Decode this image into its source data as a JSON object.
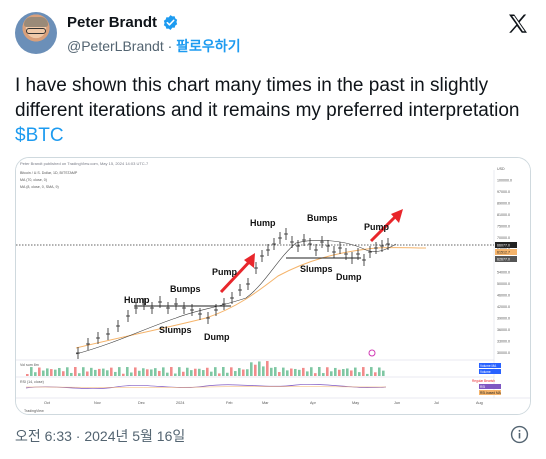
{
  "author": {
    "name": "Peter Brandt",
    "handle": "@PeterLBrandt",
    "separator": "·",
    "follow_label": "팔로우하기"
  },
  "tweet": {
    "text_before": "I have shown this chart many times in the past in slightly different iterations and it remains my preferred interpretation ",
    "cashtag": "$BTC"
  },
  "chart": {
    "header": "Peter Brandt published on TradingView.com, May 15, 2024 14:03 UTC-7",
    "symbol_line": "Bitcoin / U.S. Dollar, 1D, BITSTAMP",
    "ma_line_1": "MA (70, close, 0)",
    "ma_line_2": "MA (8, close, 0, SMA, 9)",
    "annotations": [
      "Hump",
      "Bumps",
      "Slumps",
      "Dump",
      "Pump",
      "Hump",
      "Bumps",
      "Slumps",
      "Dump",
      "Pump"
    ],
    "x_labels": [
      "Oct",
      "Nov",
      "Dec",
      "2024",
      "Feb",
      "Mar",
      "Apr",
      "May",
      "Jun",
      "Jul",
      "Aug"
    ],
    "y_labels": [
      "USD",
      "100000.0",
      "97000.0",
      "89000.0",
      "81000.0",
      "75000.0",
      "70000.0",
      "64000.0",
      "59000.0",
      "54000.0",
      "50000.0",
      "46000.0",
      "42000.0",
      "39000.0",
      "36000.0",
      "33000.0",
      "30000.0"
    ],
    "price_tags": [
      "66077.0",
      "61512.7",
      "62677.0"
    ],
    "volume_label": "Vol sum 8m",
    "volume_tags": [
      "Volume MA",
      "Volume"
    ],
    "rsi_label": "RSI (14, close)",
    "rsi_tags": [
      "Regular Bearish",
      "RSI",
      "RSI-based MA"
    ],
    "brand": "TradingView",
    "colors": {
      "accent": "#1d9bf0",
      "arrow": "#e8262b",
      "ma_slow": "#f5b46b",
      "ma_fast": "#3c3c3c"
    }
  },
  "footer": {
    "timestamp": "오전 6:33 · 2024년 5월 16일"
  },
  "icons": [
    "verified-badge-icon",
    "x-logo-icon",
    "info-icon"
  ]
}
